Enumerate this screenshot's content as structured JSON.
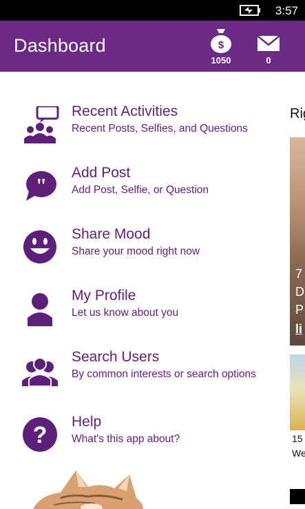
{
  "status": {
    "time": "3:57"
  },
  "header": {
    "title": "Dashboard",
    "coins_count": "1050",
    "messages_count": "0"
  },
  "menu": [
    {
      "title": "Recent Activities",
      "subtitle": "Recent Posts, Selfies, and Questions",
      "icon": "people-chat-icon"
    },
    {
      "title": "Add Post",
      "subtitle": "Add Post, Selfie, or Question",
      "icon": "quote-bubble-icon"
    },
    {
      "title": "Share Mood",
      "subtitle": "Share your mood right now",
      "icon": "smiley-icon"
    },
    {
      "title": "My Profile",
      "subtitle": "Let us know about you",
      "icon": "person-icon"
    },
    {
      "title": "Search Users",
      "subtitle": "By common interests or search options",
      "icon": "group-icon"
    },
    {
      "title": "Help",
      "subtitle": "What's this app about?",
      "icon": "question-icon"
    }
  ],
  "right_panel": {
    "heading": "Rig",
    "photo1_lines": [
      "7",
      "D",
      "P",
      "li"
    ],
    "caption_line1": "15",
    "caption_line2": "We"
  },
  "colors": {
    "brand": "#6b2a84",
    "text": "#5d1f7a"
  }
}
